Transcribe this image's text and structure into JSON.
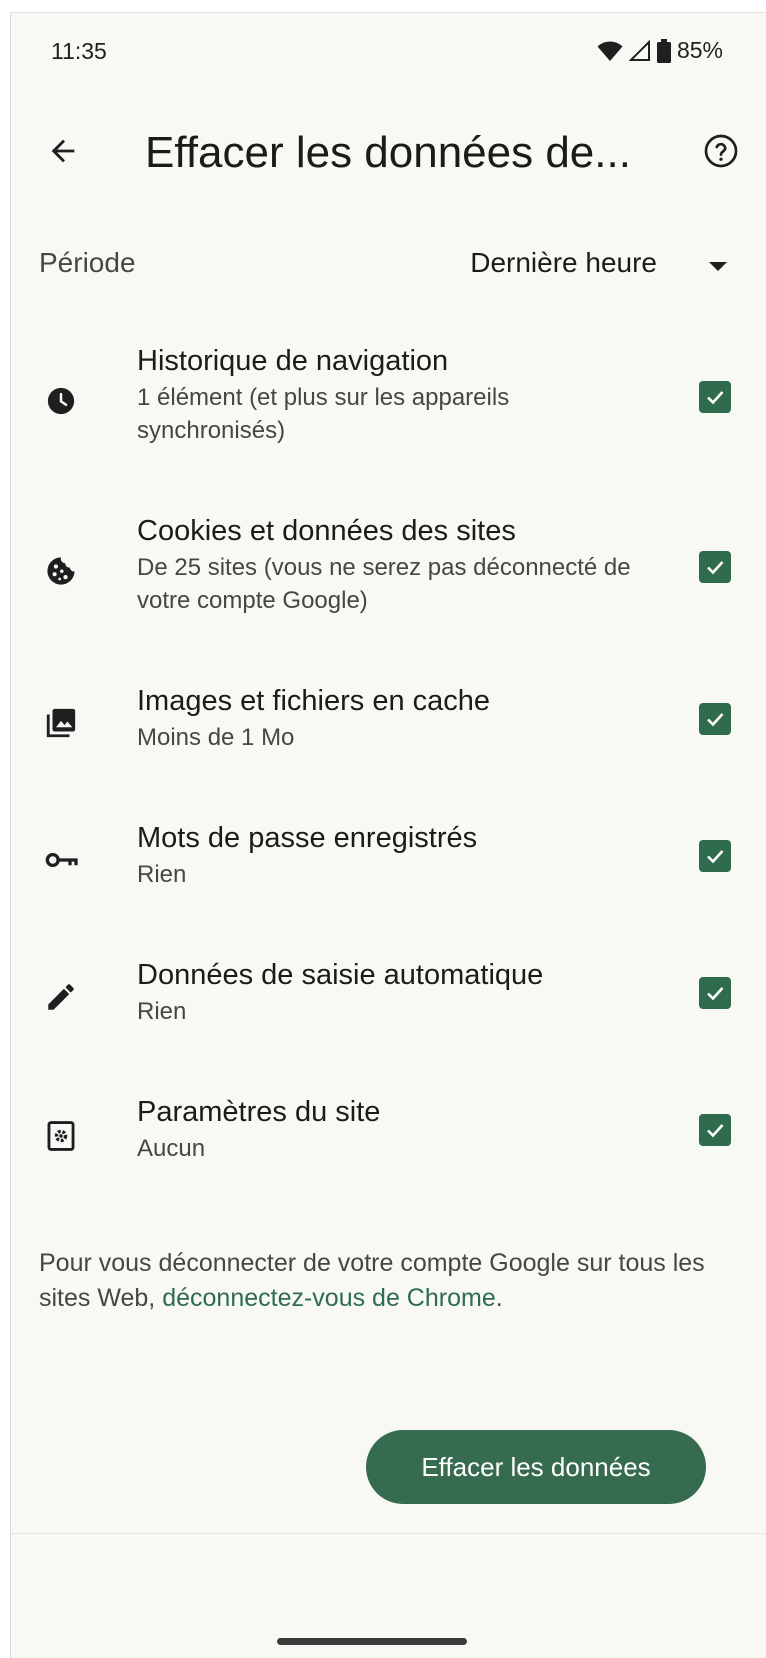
{
  "status_bar": {
    "time": "11:35",
    "battery": "85%"
  },
  "toolbar": {
    "title": "Effacer les données de...",
    "back_icon": "arrow-left-icon",
    "help_icon": "help-circle-icon"
  },
  "period": {
    "label": "Période",
    "value": "Dernière heure"
  },
  "items": [
    {
      "icon": "clock-icon",
      "title": "Historique de navigation",
      "subtitle": "1 élément (et plus sur les appareils synchronisés)",
      "checked": true
    },
    {
      "icon": "cookie-icon",
      "title": "Cookies et données des sites",
      "subtitle": "De 25 sites (vous ne serez pas déconnecté de votre compte Google)",
      "checked": true
    },
    {
      "icon": "images-icon",
      "title": "Images et fichiers en cache",
      "subtitle": "Moins de 1 Mo",
      "checked": true
    },
    {
      "icon": "key-icon",
      "title": "Mots de passe enregistrés",
      "subtitle": "Rien",
      "checked": true
    },
    {
      "icon": "pencil-icon",
      "title": "Données de saisie automatique",
      "subtitle": "Rien",
      "checked": true
    },
    {
      "icon": "settings-page-icon",
      "title": "Paramètres du site",
      "subtitle": "Aucun",
      "checked": true
    }
  ],
  "note": {
    "text": "Pour vous déconnecter de votre compte Google sur tous les sites Web, ",
    "link": "déconnectez-vous de Chrome",
    "suffix": "."
  },
  "action": {
    "clear_label": "Effacer les données"
  },
  "colors": {
    "accent": "#2f6c4d",
    "background": "#f8f9f5",
    "text": "#1b1c1a",
    "secondary_text": "#444744"
  }
}
